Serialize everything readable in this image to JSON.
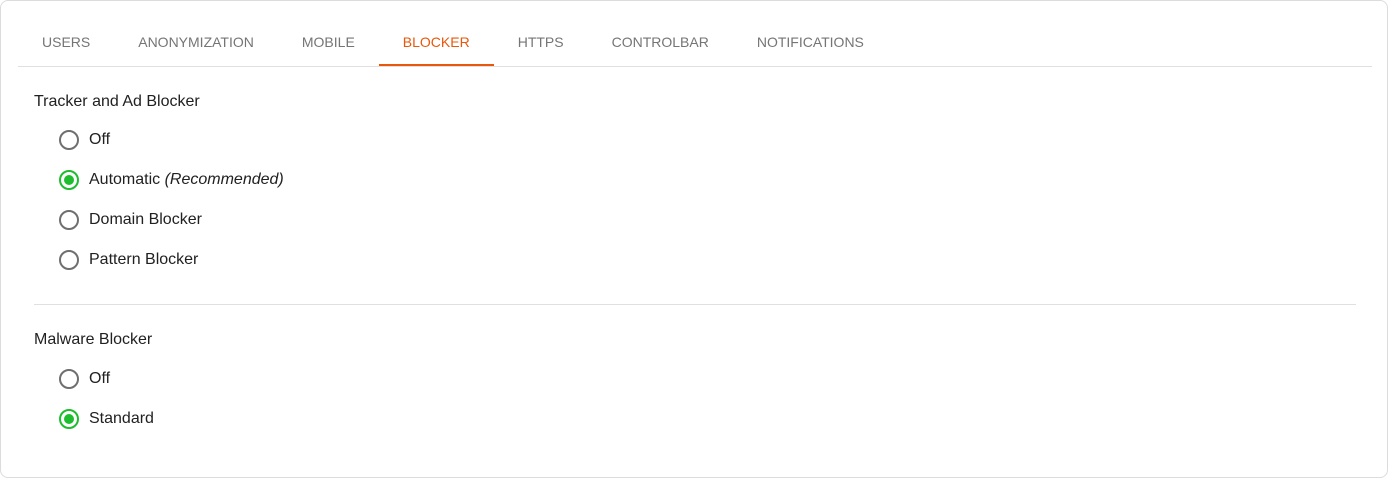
{
  "tabs": [
    {
      "label": "USERS",
      "active": false
    },
    {
      "label": "ANONYMIZATION",
      "active": false
    },
    {
      "label": "MOBILE",
      "active": false
    },
    {
      "label": "BLOCKER",
      "active": true
    },
    {
      "label": "HTTPS",
      "active": false
    },
    {
      "label": "CONTROLBAR",
      "active": false
    },
    {
      "label": "NOTIFICATIONS",
      "active": false
    }
  ],
  "tracker": {
    "title": "Tracker and Ad Blocker",
    "options": [
      {
        "label": "Off",
        "suffix": "",
        "selected": false
      },
      {
        "label": "Automatic",
        "suffix": "(Recommended)",
        "selected": true
      },
      {
        "label": "Domain Blocker",
        "suffix": "",
        "selected": false
      },
      {
        "label": "Pattern Blocker",
        "suffix": "",
        "selected": false
      }
    ]
  },
  "malware": {
    "title": "Malware Blocker",
    "options": [
      {
        "label": "Off",
        "suffix": "",
        "selected": false
      },
      {
        "label": "Standard",
        "suffix": "",
        "selected": true
      }
    ]
  },
  "colors": {
    "accent": "#e8580c",
    "radio_selected": "#1ebd2f"
  }
}
